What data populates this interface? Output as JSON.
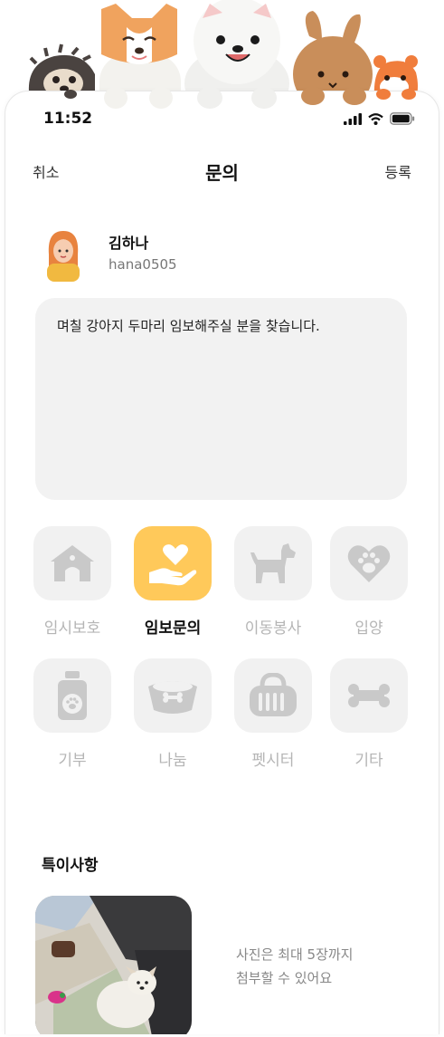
{
  "status_bar": {
    "time": "11:52"
  },
  "nav": {
    "cancel": "취소",
    "title": "문의",
    "submit": "등록"
  },
  "profile": {
    "name": "김하나",
    "user_id": "hana0505"
  },
  "memo": {
    "text": "며칠 강아지 두마리 임보해주실 분을 찾습니다."
  },
  "categories": [
    {
      "label": "임시보호",
      "icon": "doghouse-icon",
      "selected": false
    },
    {
      "label": "임보문의",
      "icon": "heart-hand-icon",
      "selected": true
    },
    {
      "label": "이동봉사",
      "icon": "dog-icon",
      "selected": false
    },
    {
      "label": "입양",
      "icon": "heart-paw-icon",
      "selected": false
    },
    {
      "label": "기부",
      "icon": "food-bottle-icon",
      "selected": false
    },
    {
      "label": "나눔",
      "icon": "bowl-icon",
      "selected": false
    },
    {
      "label": "펫시터",
      "icon": "carrier-icon",
      "selected": false
    },
    {
      "label": "기타",
      "icon": "bone-icon",
      "selected": false
    }
  ],
  "notes": {
    "title": "특이사항",
    "photo_hint_line1": "사진은 최대 5장까지",
    "photo_hint_line2": "첨부할 수 있어요"
  },
  "colors": {
    "accent": "#ffc95a",
    "inactive_tile": "#f1f1f1",
    "inactive_icon": "#c9c9c9",
    "inactive_text": "#b5b5b5"
  }
}
